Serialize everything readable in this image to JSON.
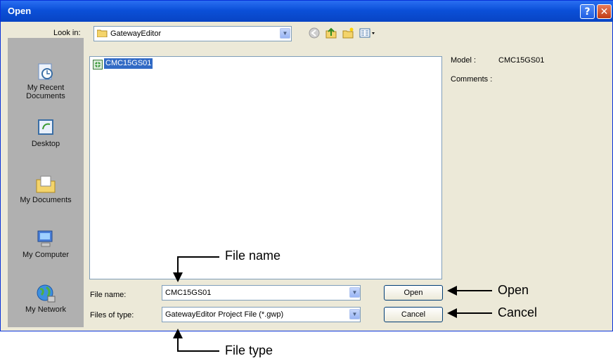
{
  "window": {
    "title": "Open",
    "help_icon": "help-icon",
    "close_icon": "close-icon"
  },
  "toolbar": {
    "look_in_label": "Look in:",
    "look_in_value": "GatewayEditor"
  },
  "places": [
    {
      "label_line1": "My Recent",
      "label_line2": "Documents",
      "icon": "recent-documents-icon"
    },
    {
      "label_line1": "Desktop",
      "label_line2": "",
      "icon": "desktop-icon"
    },
    {
      "label_line1": "My Documents",
      "label_line2": "",
      "icon": "my-documents-icon"
    },
    {
      "label_line1": "My Computer",
      "label_line2": "",
      "icon": "my-computer-icon"
    },
    {
      "label_line1": "My Network",
      "label_line2": "",
      "icon": "my-network-icon"
    }
  ],
  "file_list": {
    "items": [
      {
        "name": "CMC15GS01",
        "selected": true
      }
    ]
  },
  "info_panel": {
    "model_label": "Model :",
    "model_value": "CMC15GS01",
    "comments_label": "Comments :"
  },
  "form": {
    "file_name_label": "File name:",
    "file_name_value": "CMC15GS01",
    "file_type_label": "Files of type:",
    "file_type_value": "GatewayEditor Project File (*.gwp)"
  },
  "buttons": {
    "open": "Open",
    "cancel": "Cancel"
  },
  "annotations": {
    "file_name": "File name",
    "open": "Open",
    "cancel": "Cancel",
    "file_type": "File type"
  }
}
